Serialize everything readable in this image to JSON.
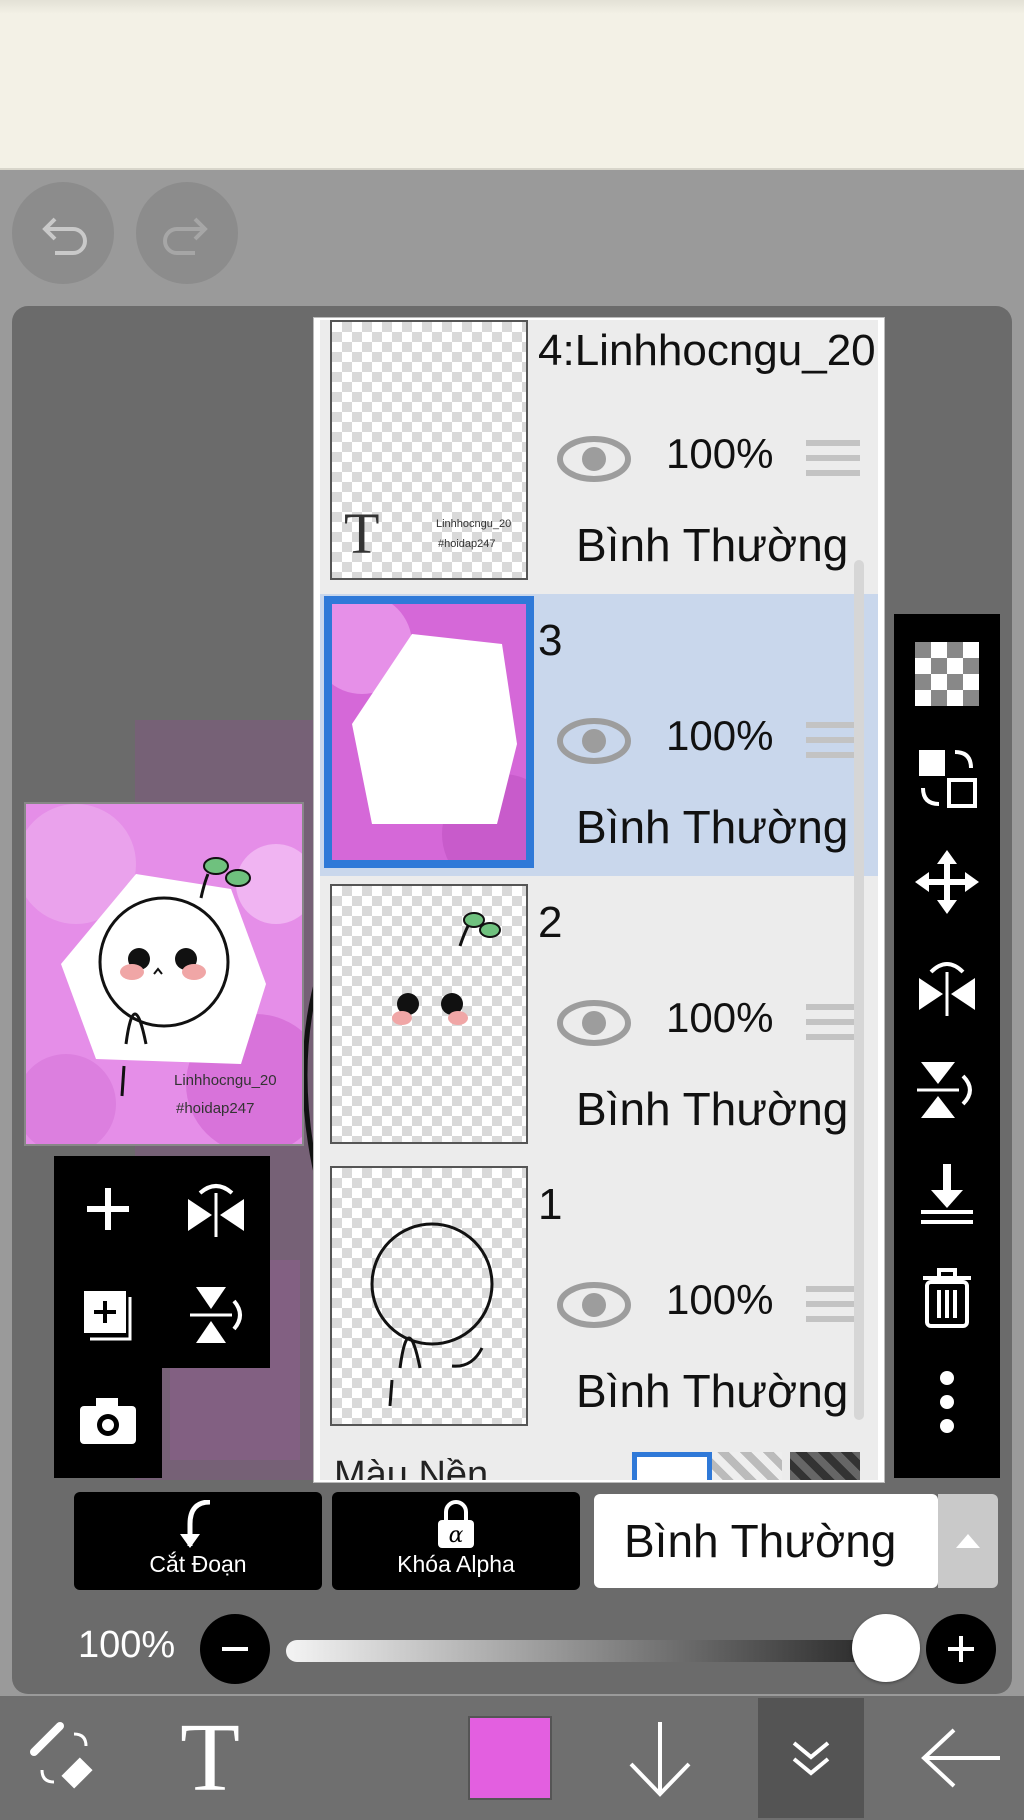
{
  "history": {
    "undo_icon": "undo-icon",
    "redo_icon": "redo-icon"
  },
  "preview": {
    "watermark_line1": "Linhhocngu_20",
    "watermark_line2": "#hoidap247"
  },
  "layers": [
    {
      "name": "4:Linhhocngu_20",
      "opacity": "100%",
      "blend": "Bình Thường",
      "selected": false,
      "thumb_text1": "Linhhocngu_20",
      "thumb_text2": "#hoidap247",
      "thumb_glyph": "T"
    },
    {
      "name": "3",
      "opacity": "100%",
      "blend": "Bình Thường",
      "selected": true
    },
    {
      "name": "2",
      "opacity": "100%",
      "blend": "Bình Thường",
      "selected": false
    },
    {
      "name": "1",
      "opacity": "100%",
      "blend": "Bình Thường",
      "selected": false
    }
  ],
  "background_row": {
    "label": "Màu Nền"
  },
  "bottom_controls": {
    "clip_label": "Cắt Đoạn",
    "alpha_lock_label": "Khóa Alpha",
    "alpha_lock_glyph": "α",
    "blend_mode": "Bình Thường"
  },
  "opacity_slider": {
    "value_label": "100%",
    "value": 1.0
  },
  "bottom_toolbar": {
    "text_tool_glyph": "T",
    "color": "#e35fe0"
  },
  "colors": {
    "selected_layer_bg": "#c9d7ec",
    "selected_border": "#2f79d8",
    "current_color": "#e35fe0"
  }
}
